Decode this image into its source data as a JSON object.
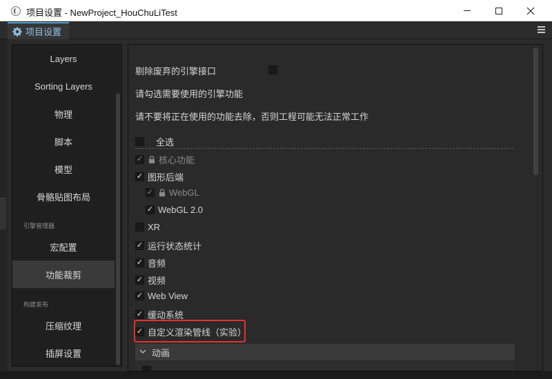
{
  "window": {
    "title": "项目设置 - NewProject_HouChuLiTest"
  },
  "tab": {
    "label": "项目设置",
    "icon": "gear-icon"
  },
  "nav": {
    "items": [
      {
        "label": "Layers"
      },
      {
        "label": "Sorting Layers"
      },
      {
        "label": "物理"
      },
      {
        "label": "脚本"
      },
      {
        "label": "模型"
      },
      {
        "label": "骨骼贴图布局"
      },
      {
        "label": "宏配置"
      },
      {
        "label": "功能裁剪",
        "active": true
      },
      {
        "label": "压缩纹理"
      },
      {
        "label": "插屏设置"
      }
    ],
    "sections": {
      "engine_manager": "引擎管理器",
      "build_publish": "构建发布"
    }
  },
  "main": {
    "remove_deprecated_label": "剔除废弃的引擎接口",
    "remove_deprecated_checked": false,
    "info_line_1": "请勾选需要使用的引擎功能",
    "info_line_2": "请不要将正在使用的功能去除，否则工程可能无法正常工作",
    "select_all_label": "全选",
    "select_all_checked": false,
    "features": [
      {
        "label": "核心功能",
        "checked": true,
        "locked": true,
        "disabled": true,
        "level": 0
      },
      {
        "label": "图形后端",
        "checked": true,
        "locked": false,
        "disabled": false,
        "level": 0
      },
      {
        "label": "WebGL",
        "checked": true,
        "locked": true,
        "disabled": true,
        "level": 1
      },
      {
        "label": "WebGL 2.0",
        "checked": true,
        "locked": false,
        "disabled": false,
        "level": 1
      },
      {
        "label": "XR",
        "checked": false,
        "locked": false,
        "disabled": false,
        "level": 0
      },
      {
        "label": "运行状态统计",
        "checked": true,
        "locked": false,
        "disabled": false,
        "level": 0
      },
      {
        "label": "音频",
        "checked": true,
        "locked": false,
        "disabled": false,
        "level": 0
      },
      {
        "label": "视频",
        "checked": true,
        "locked": false,
        "disabled": false,
        "level": 0
      },
      {
        "label": "Web View",
        "checked": true,
        "locked": false,
        "disabled": false,
        "level": 0
      },
      {
        "label": "缓动系统",
        "checked": true,
        "locked": false,
        "disabled": false,
        "level": 0
      },
      {
        "label": "自定义渲染管线（实验）",
        "checked": true,
        "locked": false,
        "disabled": false,
        "level": 0
      }
    ],
    "group_label": "动画",
    "highlight_color": "#e5332a",
    "accent_color": "#4fa0d8"
  }
}
